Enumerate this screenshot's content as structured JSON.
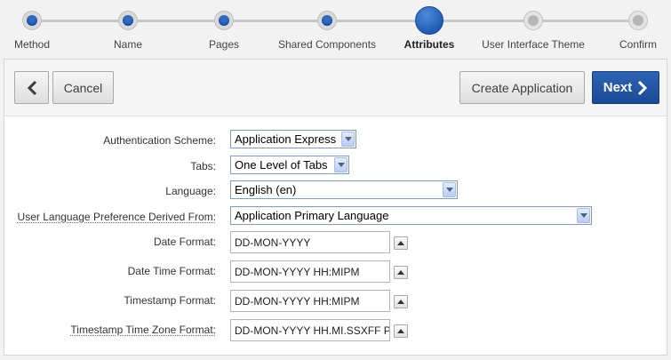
{
  "wizard": {
    "steps": [
      {
        "label": "Method",
        "state": "done"
      },
      {
        "label": "Name",
        "state": "done"
      },
      {
        "label": "Pages",
        "state": "done"
      },
      {
        "label": "Shared Components",
        "state": "done"
      },
      {
        "label": "Attributes",
        "state": "current"
      },
      {
        "label": "User Interface Theme",
        "state": "todo"
      },
      {
        "label": "Confirm",
        "state": "todo"
      }
    ]
  },
  "toolbar": {
    "cancel_label": "Cancel",
    "create_label": "Create Application",
    "next_label": "Next"
  },
  "form": {
    "auth_scheme": {
      "label": "Authentication Scheme:",
      "value": "Application Express"
    },
    "tabs": {
      "label": "Tabs:",
      "value": "One Level of Tabs"
    },
    "language": {
      "label": "Language:",
      "value": "English (en)"
    },
    "user_lang_pref": {
      "label": "User Language Preference Derived From:",
      "value": "Application Primary Language"
    },
    "date_format": {
      "label": "Date Format:",
      "value": "DD-MON-YYYY"
    },
    "date_time_format": {
      "label": "Date Time Format:",
      "value": "DD-MON-YYYY HH:MIPM"
    },
    "timestamp_format": {
      "label": "Timestamp Format:",
      "value": "DD-MON-YYYY HH:MIPM"
    },
    "timestamp_tz_format": {
      "label": "Timestamp Time Zone Format:",
      "value": "DD-MON-YYYY HH.MI.SSXFF PM TZR"
    }
  },
  "colors": {
    "accent": "#1f5cb5",
    "next_button": "#2d63b5",
    "step_todo": "#b6b6b6"
  },
  "icons": {
    "back": "chevron-left-icon",
    "next": "chevron-right-icon",
    "picker": "triangle-up-icon",
    "dropdown": "chevron-down-icon"
  }
}
